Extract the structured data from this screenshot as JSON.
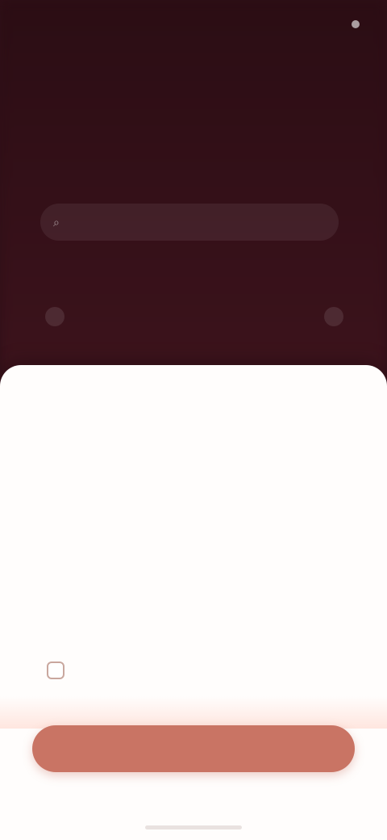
{
  "status_bar": {
    "time": "",
    "right": ""
  },
  "background": {
    "tabs": [
      "",
      ""
    ],
    "search_placeholder": "",
    "row_label": ""
  },
  "sheet": {
    "title": "",
    "body": "",
    "note": "",
    "consent_label": "",
    "button_label": ""
  },
  "colors": {
    "background": "#2f0f17",
    "sheet": "#fffdfc",
    "accent": "#c97464",
    "title": "#c8806e"
  }
}
